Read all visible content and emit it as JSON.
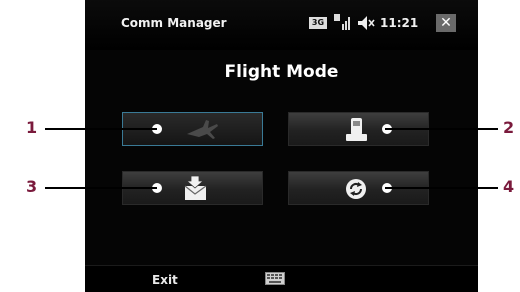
{
  "status_bar": {
    "app_title": "Comm Manager",
    "network": "3G",
    "time": "11:21",
    "close": "✕"
  },
  "heading": "Flight Mode",
  "buttons": [
    {
      "id": 1,
      "icon": "airplane-icon",
      "state": "focused"
    },
    {
      "id": 2,
      "icon": "phone-icon",
      "state": "normal"
    },
    {
      "id": 3,
      "icon": "mail-download-icon",
      "state": "normal"
    },
    {
      "id": 4,
      "icon": "sync-icon",
      "state": "normal"
    }
  ],
  "callouts": [
    "1",
    "2",
    "3",
    "4"
  ],
  "softkeys": {
    "left": "Exit",
    "center_icon": "keyboard-icon"
  },
  "colors": {
    "callout_number": "#7a1a3c",
    "focus_border": "#3a7a96",
    "screen_background": "#050505"
  }
}
